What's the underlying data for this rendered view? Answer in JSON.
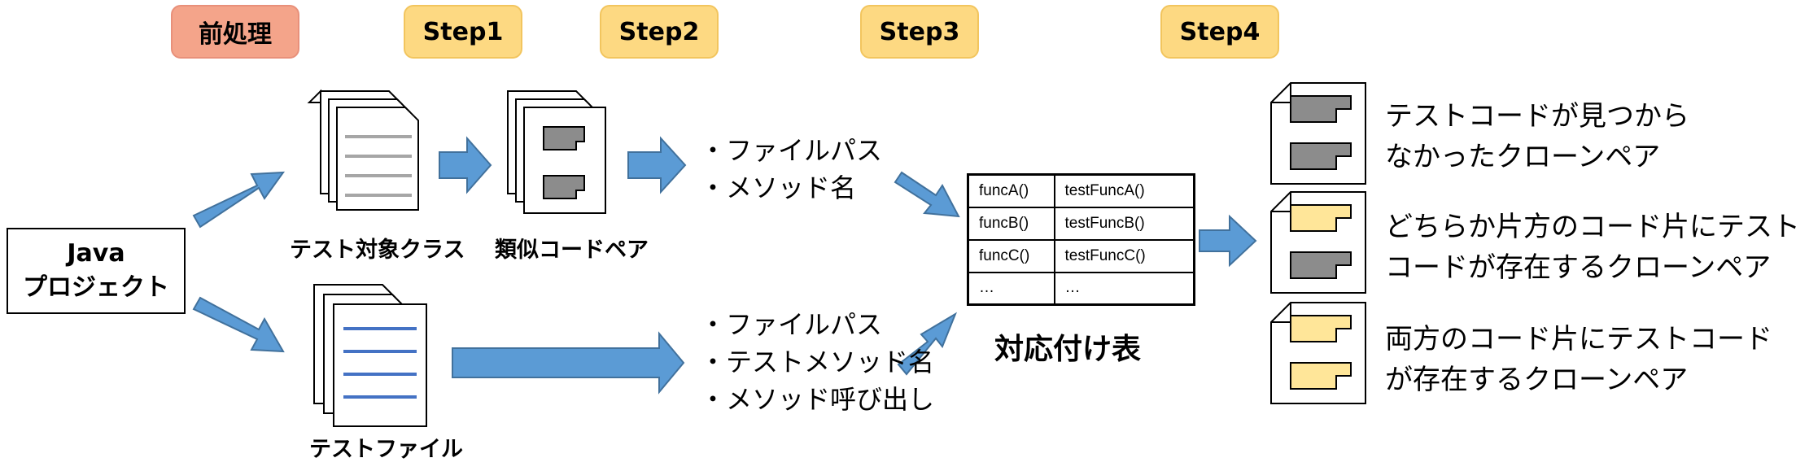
{
  "steps": {
    "pre": "前処理",
    "s1": "Step1",
    "s2": "Step2",
    "s3": "Step3",
    "s4": "Step4"
  },
  "project": {
    "line1": "Java",
    "line2": "プロジェクト"
  },
  "labels": {
    "test_target_class": "テスト対象クラス",
    "similar_code_pair": "類似コードペア",
    "test_file": "テストファイル"
  },
  "info_top": [
    "・ファイルパス",
    "・メソッド名"
  ],
  "info_bottom": [
    "・ファイルパス",
    "・テストメソッド名",
    "・メソッド呼び出し"
  ],
  "table": {
    "rows": [
      [
        "funcA()",
        "testFuncA()"
      ],
      [
        "funcB()",
        "testFuncB()"
      ],
      [
        "funcC()",
        "testFuncC()"
      ],
      [
        "…",
        "…"
      ]
    ],
    "title": "対応付け表"
  },
  "results": [
    {
      "line1": "テストコードが見つから",
      "line2": "なかったクローンペア"
    },
    {
      "line1": "どちらか片方のコード片にテスト",
      "line2": "コードが存在するクローンペア"
    },
    {
      "line1": "両方のコード片にテストコード",
      "line2": "が存在するクローンペア"
    }
  ],
  "colors": {
    "arrow": "#5b9bd5",
    "arrow_stroke": "#41719c",
    "pre_step": "#f4a48a",
    "step": "#fdd982",
    "gray_block": "#8c8c8c",
    "yellow_block": "#ffe699",
    "gray_lines": "#a6a6a6",
    "blue_lines": "#4472c4"
  }
}
